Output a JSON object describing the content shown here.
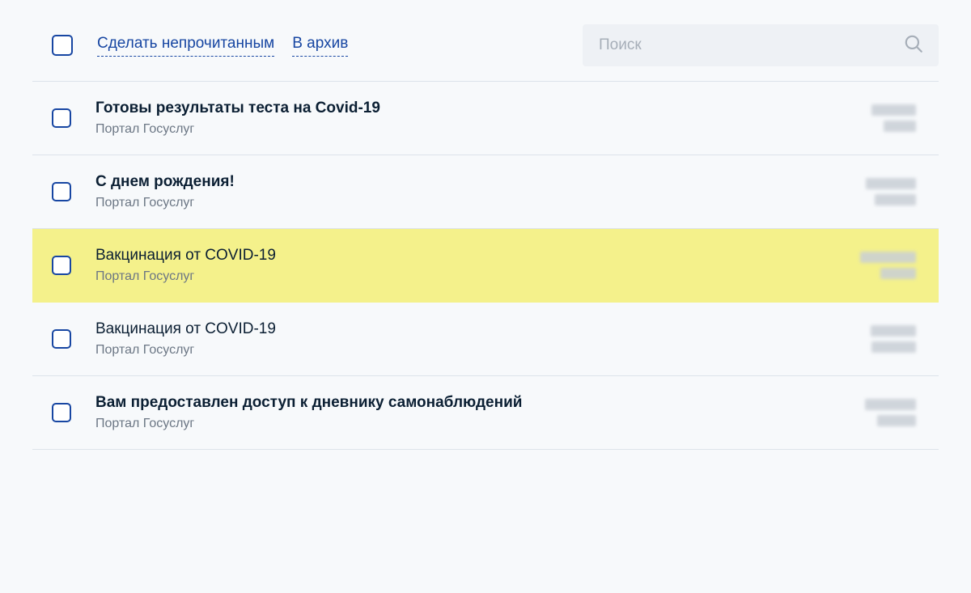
{
  "toolbar": {
    "mark_unread_label": "Сделать непрочитанным",
    "archive_label": "В архив",
    "search_placeholder": "Поиск"
  },
  "messages": [
    {
      "title": "Готовы результаты теста на Covid-19",
      "sender": "Портал Госуслуг",
      "bold": true,
      "highlight": false
    },
    {
      "title": "С днем рождения!",
      "sender": "Портал Госуслуг",
      "bold": true,
      "highlight": false
    },
    {
      "title": "Вакцинация от COVID-19",
      "sender": "Портал Госуслуг",
      "bold": false,
      "highlight": true
    },
    {
      "title": "Вакцинация от COVID-19",
      "sender": "Портал Госуслуг",
      "bold": false,
      "highlight": false
    },
    {
      "title": "Вам предоставлен доступ к дневнику самонаблюдений",
      "sender": "Портал Госуслуг",
      "bold": true,
      "highlight": false
    }
  ]
}
